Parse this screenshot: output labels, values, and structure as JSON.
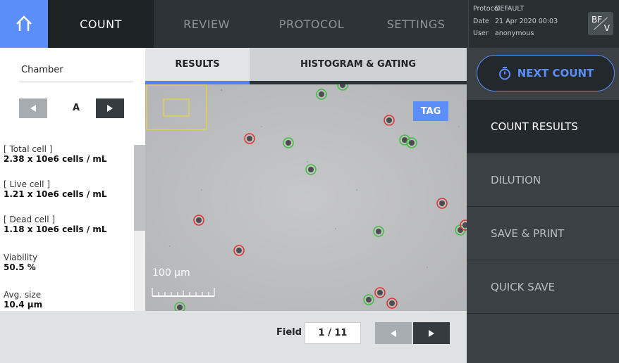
{
  "topbar": {
    "home_icon": "home-icon",
    "tabs": [
      {
        "label": "COUNT",
        "active": true
      },
      {
        "label": "REVIEW",
        "active": false
      },
      {
        "label": "PROTOCOL",
        "active": false
      },
      {
        "label": "SETTINGS",
        "active": false
      }
    ],
    "info": {
      "protocol_key": "Protocol",
      "protocol_val": "DEFAULT",
      "date_key": "Date",
      "date_val": "21 Apr 2020 00:03",
      "user_key": "User",
      "user_val": "anonymous"
    },
    "mode": {
      "top": "BF",
      "bottom": "V"
    }
  },
  "left": {
    "chamber_label": "Chamber",
    "chamber_value": "A",
    "results": [
      {
        "label": "[ Total cell ]",
        "value": "2.38 x 10e6 cells / mL"
      },
      {
        "label": "[ Live cell ]",
        "value": "1.21 x 10e6 cells / mL"
      },
      {
        "label": "[ Dead cell ]",
        "value": "1.18 x 10e6 cells / mL"
      },
      {
        "label": "Viability",
        "value": "50.5 %"
      },
      {
        "label": "Avg. size",
        "value": "10.4 μm"
      }
    ]
  },
  "content_tabs": {
    "results": "RESULTS",
    "histogram": "HISTOGRAM & GATING"
  },
  "viewer": {
    "tag_label": "TAG",
    "scale_label": "100 μm",
    "live_color": "#3fbf3f",
    "dead_color": "#e03030"
  },
  "field": {
    "label": "Field",
    "value": "1 / 11"
  },
  "right": {
    "next_count_label": "NEXT COUNT",
    "menu": [
      {
        "label": "COUNT RESULTS",
        "active": true
      },
      {
        "label": "DILUTION",
        "active": false
      },
      {
        "label": "SAVE & PRINT",
        "active": false
      },
      {
        "label": "QUICK SAVE",
        "active": false
      }
    ]
  },
  "colors": {
    "accent": "#5b8ef8",
    "dark": "#2d3336"
  }
}
